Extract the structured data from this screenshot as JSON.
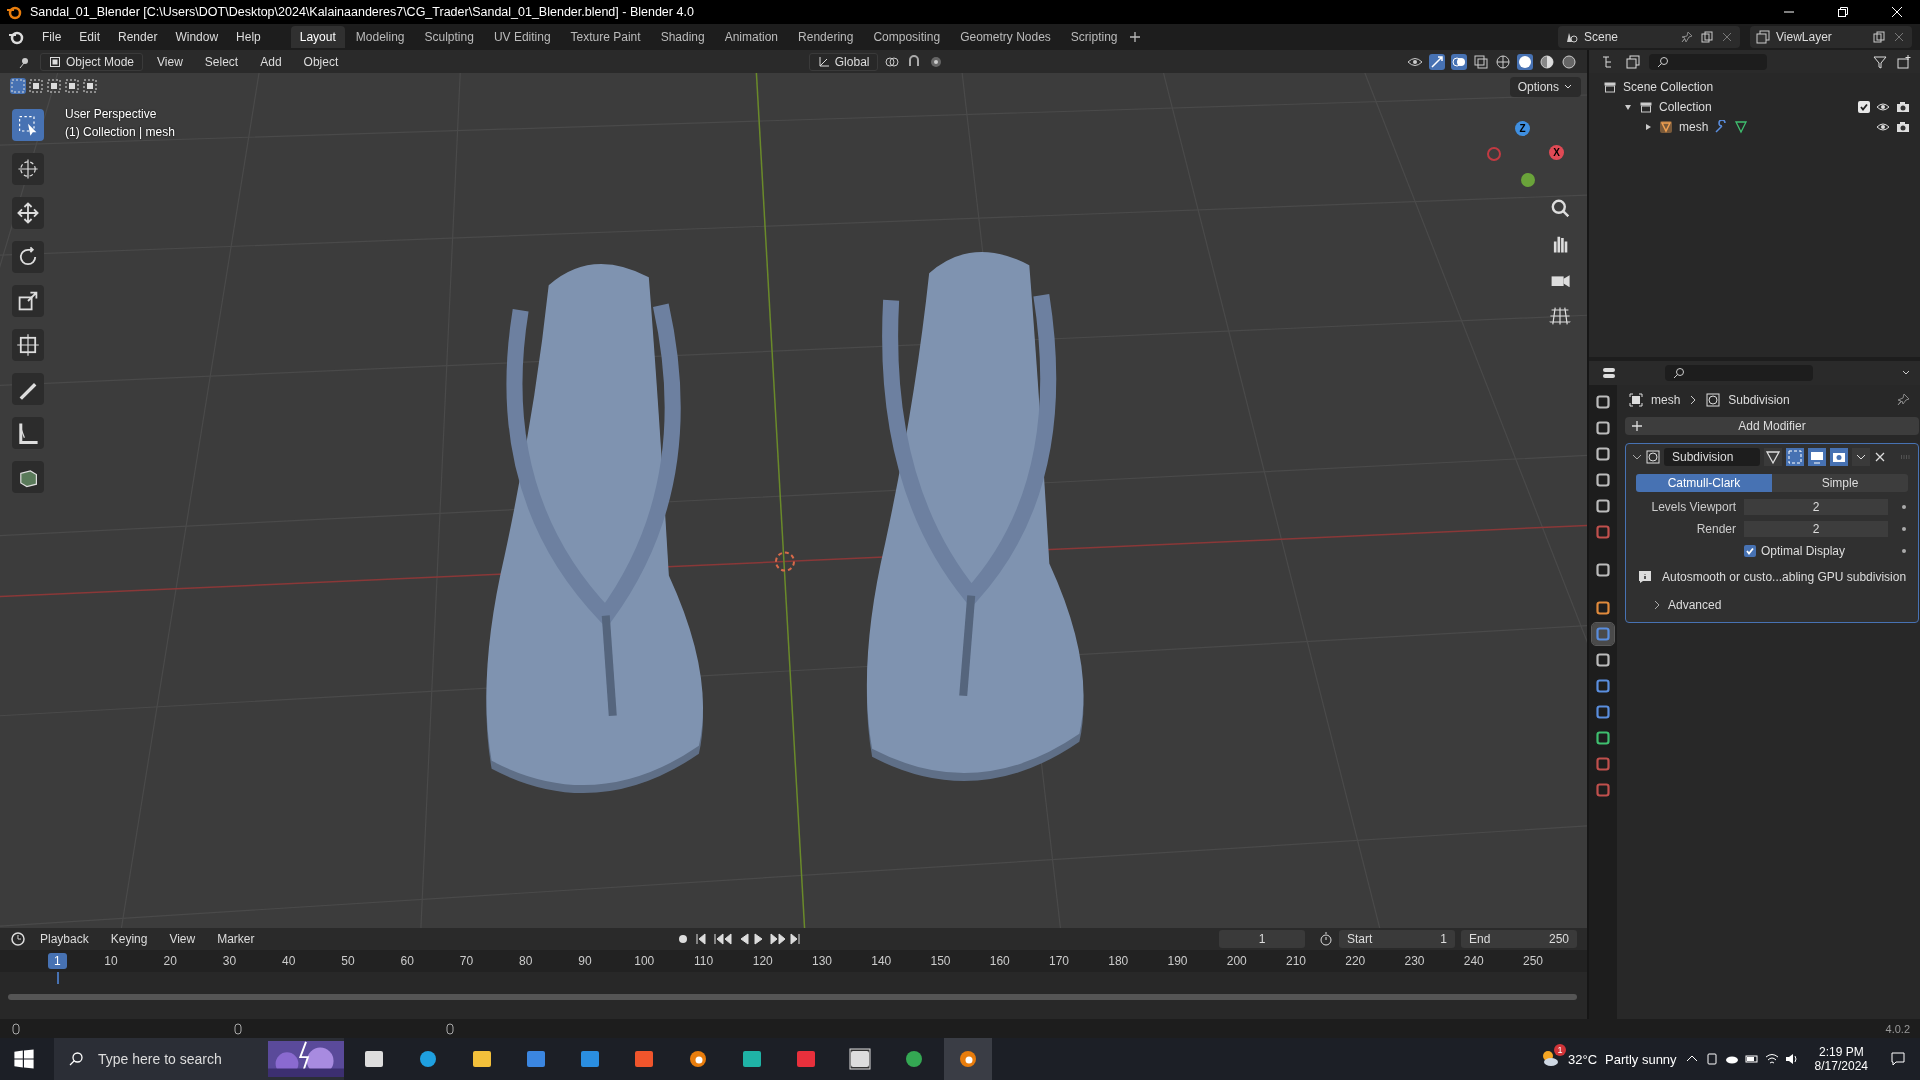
{
  "window": {
    "title": "Sandal_01_Blender [C:\\Users\\DOT\\Desktop\\2024\\Kalainaanderes7\\CG_Trader\\Sandal_01_Blender.blend] - Blender 4.0"
  },
  "menu": [
    "File",
    "Edit",
    "Render",
    "Window",
    "Help"
  ],
  "workspaces": [
    {
      "label": "Layout",
      "selected": true
    },
    {
      "label": "Modeling",
      "selected": false
    },
    {
      "label": "Sculpting",
      "selected": false
    },
    {
      "label": "UV Editing",
      "selected": false
    },
    {
      "label": "Texture Paint",
      "selected": false
    },
    {
      "label": "Shading",
      "selected": false
    },
    {
      "label": "Animation",
      "selected": false
    },
    {
      "label": "Rendering",
      "selected": false
    },
    {
      "label": "Compositing",
      "selected": false
    },
    {
      "label": "Geometry Nodes",
      "selected": false
    },
    {
      "label": "Scripting",
      "selected": false
    }
  ],
  "scene": "Scene",
  "view_layer": "ViewLayer",
  "viewport": {
    "mode": "Object Mode",
    "menus": [
      "View",
      "Select",
      "Add",
      "Object"
    ],
    "orientation": "Global",
    "options": "Options",
    "overlay_lines": [
      "User Perspective",
      "(1) Collection | mesh"
    ],
    "gizmo": {
      "z": "Z",
      "x": "X"
    }
  },
  "outliner": {
    "items": [
      {
        "label": "Scene Collection",
        "kind": "scene",
        "children": [
          {
            "label": "Collection",
            "kind": "collection",
            "expanded": true,
            "checked": true,
            "children": [
              {
                "label": "mesh",
                "kind": "object",
                "expanded": false
              }
            ]
          }
        ]
      }
    ]
  },
  "properties": {
    "tabs": [
      {
        "selected": false
      },
      {
        "selected": false
      },
      {
        "selected": false
      },
      {
        "selected": false
      },
      {
        "selected": false
      },
      {
        "selected": false
      },
      {
        "selected": false
      },
      {
        "selected": false
      },
      {
        "selected": true
      },
      {
        "selected": false
      },
      {
        "selected": false
      },
      {
        "selected": false
      },
      {
        "selected": false
      },
      {
        "selected": false
      },
      {
        "selected": false
      }
    ],
    "breadcrumb": [
      "mesh",
      "Subdivision"
    ],
    "add_modifier": "Add Modifier",
    "modifier": {
      "name": "Subdivision",
      "expanded": true,
      "types": [
        {
          "label": "Catmull-Clark",
          "selected": true
        },
        {
          "label": "Simple",
          "selected": false
        }
      ],
      "fields": [
        {
          "label": "Levels Viewport",
          "value": "2"
        },
        {
          "label": "Render",
          "value": "2"
        }
      ],
      "optimal_display": {
        "label": "Optimal Display",
        "checked": true
      },
      "info": "Autosmooth or custo...abling GPU subdivision",
      "advanced": {
        "label": "Advanced",
        "expanded": false
      }
    }
  },
  "timeline": {
    "menus": [
      "Playback",
      "Keying",
      "View",
      "Marker"
    ],
    "current_frame": "1",
    "start_label": "Start",
    "start": "1",
    "end_label": "End",
    "end": "250",
    "playhead": "1",
    "ruler": [
      "10",
      "20",
      "30",
      "40",
      "50",
      "60",
      "70",
      "80",
      "90",
      "100",
      "110",
      "120",
      "130",
      "140",
      "150",
      "160",
      "170",
      "180",
      "190",
      "200",
      "210",
      "220",
      "230",
      "240",
      "250"
    ]
  },
  "status_bar": {
    "version": "4.0.2"
  },
  "taskbar": {
    "search_placeholder": "Type here to search",
    "weather_badge": "1",
    "temperature": "32°C",
    "weather": "Partly sunny",
    "time": "2:19 PM",
    "date": "8/17/2024"
  }
}
